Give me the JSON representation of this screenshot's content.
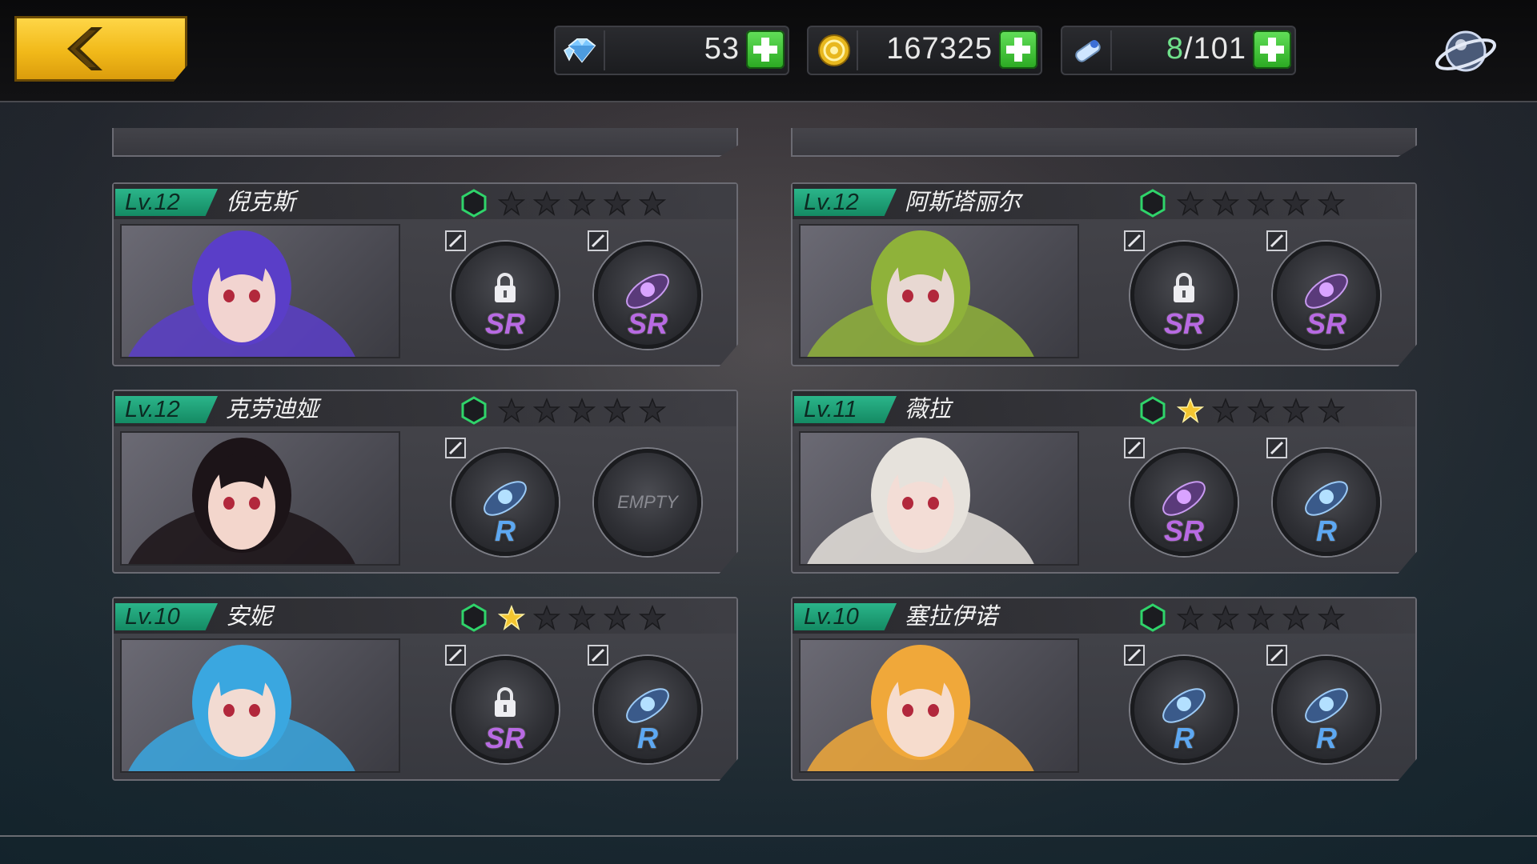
{
  "header": {
    "back_label": "",
    "resources": [
      {
        "name": "diamonds",
        "icon": "diamond-icon",
        "value": "53"
      },
      {
        "name": "gold",
        "icon": "gold-coin-icon",
        "value": "167325"
      },
      {
        "name": "tickets",
        "icon": "ticket-icon",
        "value_current": "8",
        "value_max": "/101"
      }
    ],
    "settings_icon": "planet-ring-icon"
  },
  "colors": {
    "accent_gold": "#f1b919",
    "level_green": "#1ca276",
    "plus_green": "#3bc431",
    "sr_purple": "#b86ae3",
    "r_blue": "#5da8f2",
    "star_gold": "#f4c630"
  },
  "characters": [
    {
      "level": "Lv.12",
      "name": "倪克斯",
      "stars": 0,
      "hair": "#5a3ec8",
      "skin": "#f2d4d0",
      "slots": [
        {
          "rank": "SR",
          "locked": true
        },
        {
          "rank": "SR",
          "locked": false
        }
      ]
    },
    {
      "level": "Lv.12",
      "name": "阿斯塔丽尔",
      "stars": 0,
      "hair": "#8fb23a",
      "skin": "#e8d8d2",
      "slots": [
        {
          "rank": "SR",
          "locked": true
        },
        {
          "rank": "SR",
          "locked": false
        }
      ]
    },
    {
      "level": "Lv.12",
      "name": "克劳迪娅",
      "stars": 0,
      "hair": "#1c1418",
      "skin": "#f3d6cc",
      "slots": [
        {
          "rank": "R",
          "locked": false
        },
        {
          "rank": "",
          "locked": false,
          "empty": true,
          "empty_label": "EMPTY"
        }
      ]
    },
    {
      "level": "Lv.11",
      "name": "薇拉",
      "stars": 1,
      "hair": "#e6e2dc",
      "skin": "#f3ddd6",
      "slots": [
        {
          "rank": "SR",
          "locked": false
        },
        {
          "rank": "R",
          "locked": false
        }
      ]
    },
    {
      "level": "Lv.10",
      "name": "安妮",
      "stars": 1,
      "hair": "#3aa7e0",
      "skin": "#f2dbd2",
      "slots": [
        {
          "rank": "SR",
          "locked": true
        },
        {
          "rank": "R",
          "locked": false
        }
      ]
    },
    {
      "level": "Lv.10",
      "name": "塞拉伊诺",
      "stars": 0,
      "hair": "#f0a83a",
      "skin": "#f6dccd",
      "slots": [
        {
          "rank": "R",
          "locked": false
        },
        {
          "rank": "R",
          "locked": false
        }
      ]
    }
  ]
}
